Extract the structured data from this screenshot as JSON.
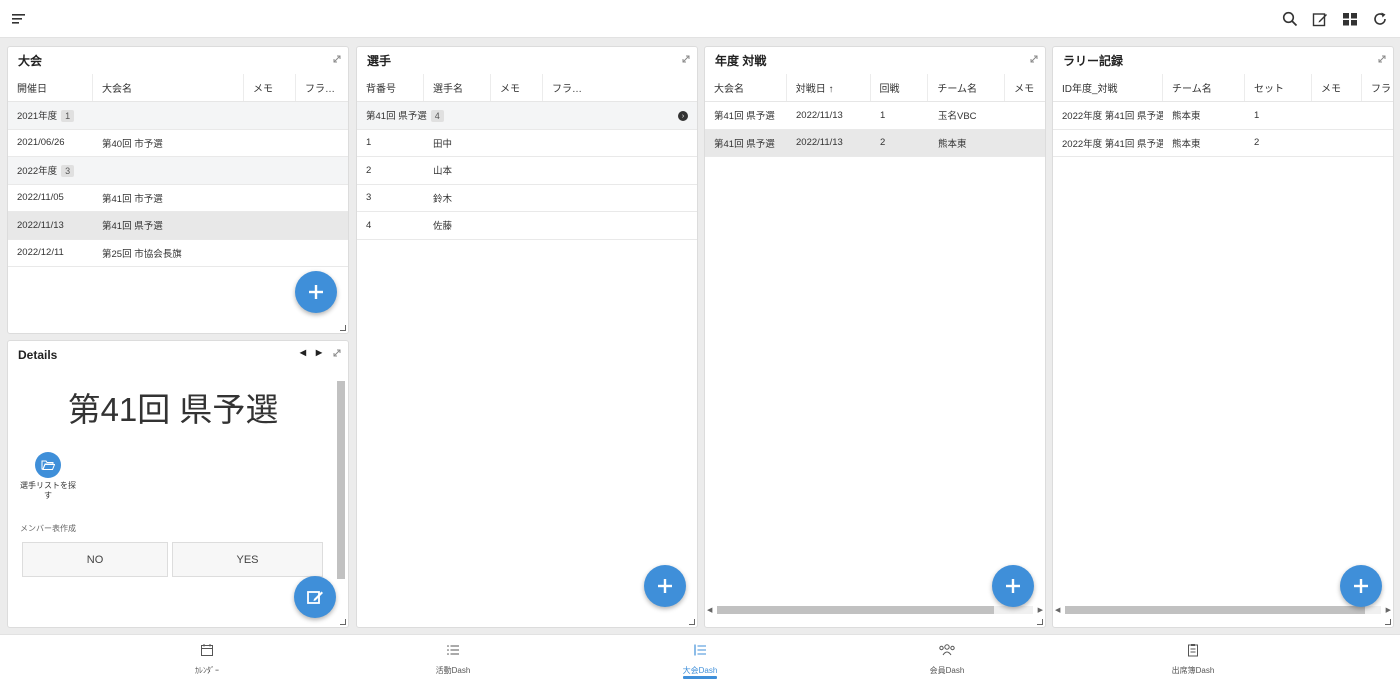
{
  "app": {
    "accent": "#3f8fd9"
  },
  "toolbar": {
    "icons": [
      "menu-icon",
      "search-icon",
      "edit-icon",
      "grid-icon",
      "refresh-icon"
    ]
  },
  "taikai": {
    "title": "大会",
    "columns": [
      "開催日",
      "大会名",
      "メモ",
      "フラ…"
    ],
    "rows": [
      {
        "type": "group",
        "label": "2021年度",
        "count": "1"
      },
      {
        "type": "row",
        "date": "2021/06/26",
        "name": "第40回 市予選"
      },
      {
        "type": "group",
        "label": "2022年度",
        "count": "3"
      },
      {
        "type": "row",
        "date": "2022/11/05",
        "name": "第41回 市予選"
      },
      {
        "type": "row",
        "date": "2022/11/13",
        "name": "第41回 県予選",
        "selected": true
      },
      {
        "type": "row",
        "date": "2022/12/11",
        "name": "第25回 市協会長旗"
      }
    ]
  },
  "details": {
    "title": "Details",
    "heading": "第41回 県予選",
    "action_label": "選手リストを探す",
    "section_label": "メンバー表作成",
    "no_label": "NO",
    "yes_label": "YES"
  },
  "senshu": {
    "title": "選手",
    "columns": [
      "背番号",
      "選手名",
      "メモ",
      "フラ…"
    ],
    "group": {
      "label": "第41回 県予選",
      "count": "4"
    },
    "rows": [
      {
        "num": "1",
        "name": "田中"
      },
      {
        "num": "2",
        "name": "山本"
      },
      {
        "num": "3",
        "name": "鈴木"
      },
      {
        "num": "4",
        "name": "佐藤"
      }
    ]
  },
  "matches": {
    "title": "年度 対戦",
    "columns": [
      "大会名",
      "対戦日 ↑",
      "回戦",
      "チーム名",
      "メモ"
    ],
    "rows": [
      {
        "taikai": "第41回 県予選",
        "date": "2022/11/13",
        "round": "1",
        "team": "玉名VBC"
      },
      {
        "taikai": "第41回 県予選",
        "date": "2022/11/13",
        "round": "2",
        "team": "熊本東",
        "selected": true
      }
    ]
  },
  "rally": {
    "title": "ラリー記録",
    "columns": [
      "ID年度_対戦",
      "チーム名",
      "セット",
      "メモ",
      "フラ"
    ],
    "rows": [
      {
        "id": "2022年度 第41回 県予選",
        "team": "熊本東",
        "set": "1"
      },
      {
        "id": "2022年度 第41回 県予選",
        "team": "熊本東",
        "set": "2"
      }
    ]
  },
  "nav": [
    {
      "label": "ｶﾚﾝﾀﾞｰ",
      "icon": "calendar-icon"
    },
    {
      "label": "活動Dash",
      "icon": "list-icon"
    },
    {
      "label": "大会Dash",
      "icon": "list-numbered-icon",
      "active": true
    },
    {
      "label": "会員Dash",
      "icon": "people-icon"
    },
    {
      "label": "出席簿Dash",
      "icon": "clipboard-icon"
    }
  ]
}
